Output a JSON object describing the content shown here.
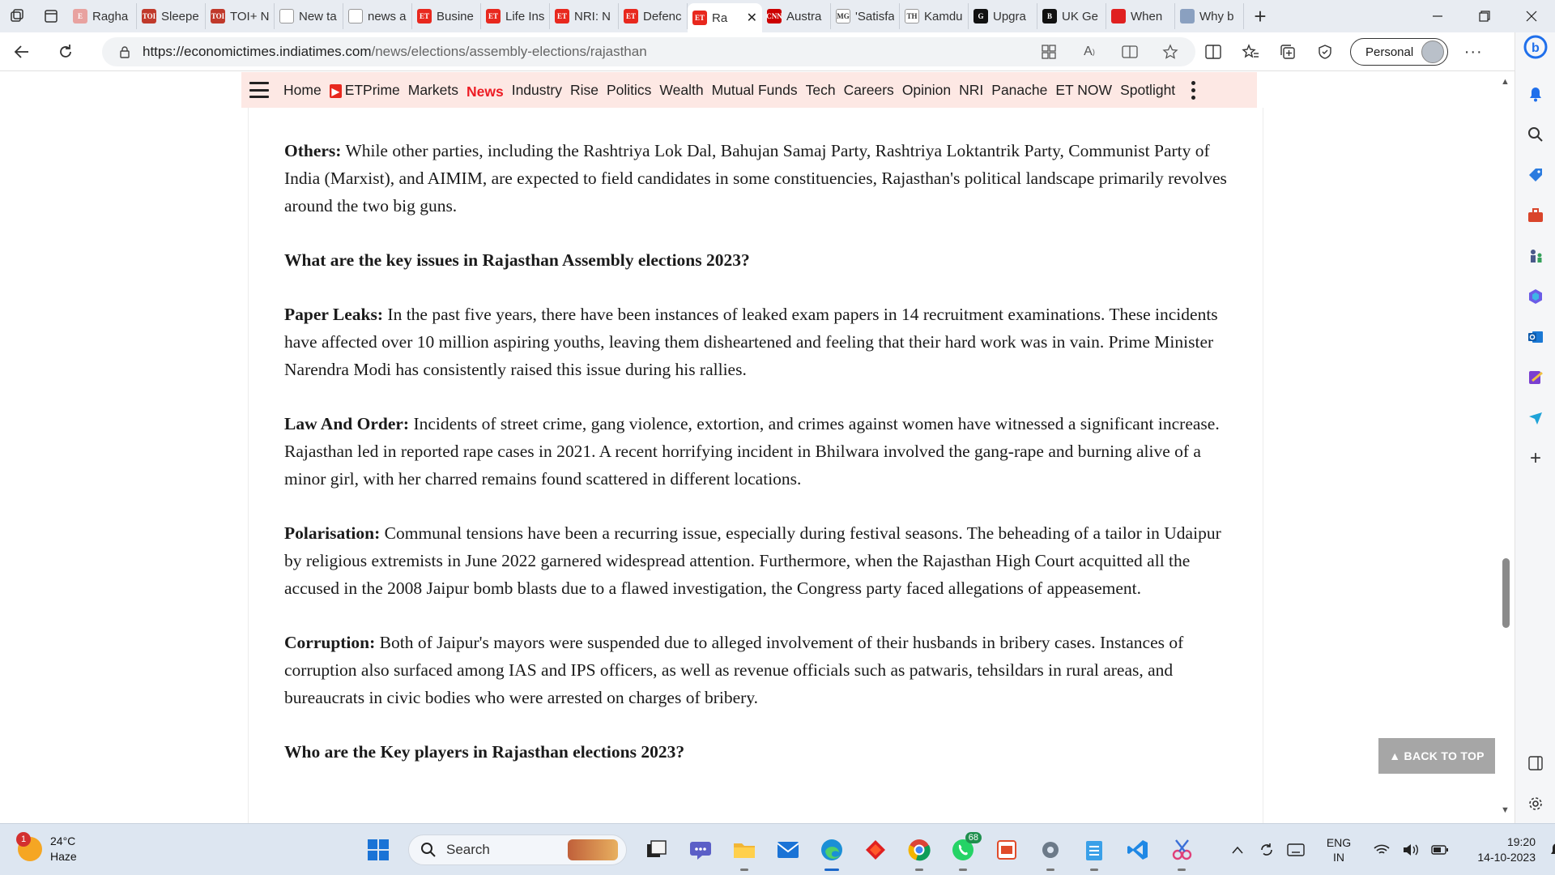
{
  "browser": {
    "tabs": [
      {
        "title": "Ragha",
        "fav_text": "E",
        "fav_color": "#e8a2a0"
      },
      {
        "title": "Sleepe",
        "fav_text": "TOI",
        "fav_color": "#c0392b"
      },
      {
        "title": "TOI+ N",
        "fav_text": "TOI",
        "fav_color": "#c0392b"
      },
      {
        "title": "New ta",
        "fav_text": "",
        "fav_color": "#ffffff"
      },
      {
        "title": "news a",
        "fav_text": "",
        "fav_color": "#ffffff"
      },
      {
        "title": "Busine",
        "fav_text": "ET",
        "fav_color": "#e8281e"
      },
      {
        "title": "Life Ins",
        "fav_text": "ET",
        "fav_color": "#e8281e"
      },
      {
        "title": "NRI: N",
        "fav_text": "ET",
        "fav_color": "#e8281e"
      },
      {
        "title": "Defenc",
        "fav_text": "ET",
        "fav_color": "#e8281e"
      },
      {
        "title": "Ra",
        "fav_text": "ET",
        "fav_color": "#e8281e",
        "active": true
      },
      {
        "title": "Austra",
        "fav_text": "CNN",
        "fav_color": "#cc0000"
      },
      {
        "title": "'Satisfa",
        "fav_text": "MG",
        "fav_color": "#ffffff"
      },
      {
        "title": "Kamdu",
        "fav_text": "TH",
        "fav_color": "#ffffff"
      },
      {
        "title": "Upgra",
        "fav_text": "G",
        "fav_color": "#111111"
      },
      {
        "title": "UK Ge",
        "fav_text": "B",
        "fav_color": "#111111"
      },
      {
        "title": "When",
        "fav_text": "",
        "fav_color": "#e02020"
      },
      {
        "title": "Why b",
        "fav_text": "",
        "fav_color": "#8aa0c0"
      }
    ],
    "url_host": "https://economictimes.indiatimes.com",
    "url_path": "/news/elections/assembly-elections/rajasthan",
    "profile_label": "Personal"
  },
  "et_nav": {
    "items": [
      "Home",
      "ETPrime",
      "Markets",
      "News",
      "Industry",
      "Rise",
      "Politics",
      "Wealth",
      "Mutual Funds",
      "Tech",
      "Careers",
      "Opinion",
      "NRI",
      "Panache",
      "ET NOW",
      "Spotlight"
    ],
    "active": "News",
    "accent": "#ed1c24",
    "bar_color": "#fde8e4"
  },
  "article": {
    "others_label": "Others:",
    "others_text": " While other parties, including the Rashtriya Lok Dal, Bahujan Samaj Party, Rashtriya Loktantrik Party, Communist Party of India (Marxist), and AIMIM, are expected to field candidates in some constituencies, Rajasthan's political landscape primarily revolves around the two big guns.",
    "heading_issues": "What are the key issues in Rajasthan Assembly elections 2023?",
    "paper_label": "Paper Leaks:",
    "paper_text": " In the past five years, there have been instances of leaked exam papers in 14 recruitment examinations. These incidents have affected over 10 million aspiring youths, leaving them disheartened and feeling that their hard work was in vain. Prime Minister Narendra Modi has consistently raised this issue during his rallies.",
    "law_label": "Law And Order:",
    "law_text": " Incidents of street crime, gang violence, extortion, and crimes against women have witnessed a significant increase. Rajasthan led in reported rape cases in 2021. A recent horrifying incident in Bhilwara involved the gang-rape and burning alive of a minor girl, with her charred remains found scattered in different locations.",
    "polar_label": "Polarisation:",
    "polar_text": " Communal tensions have been a recurring issue, especially during festival seasons. The beheading of a tailor in Udaipur by religious extremists in June 2022 garnered widespread attention. Furthermore, when the Rajasthan High Court acquitted all the accused in the 2008 Jaipur bomb blasts due to a flawed investigation, the Congress party faced allegations of appeasement.",
    "corr_label": "Corruption:",
    "corr_text": " Both of Jaipur's mayors were suspended due to alleged involvement of their husbands in bribery cases. Instances of corruption also surfaced among IAS and IPS officers, as well as revenue officials such as patwaris, tehsildars in rural areas, and bureaucrats in civic bodies who were arrested on charges of bribery.",
    "heading_players": "Who are the Key players in Rajasthan elections 2023?"
  },
  "back_to_top_label": "▲ BACK TO TOP",
  "taskbar": {
    "weather_temp": "24°C",
    "weather_desc": "Haze",
    "weather_badge": "1",
    "search_placeholder": "Search",
    "whatsapp_badge": "68",
    "lang_top": "ENG",
    "lang_bottom": "IN",
    "time": "19:20",
    "date": "14-10-2023"
  }
}
